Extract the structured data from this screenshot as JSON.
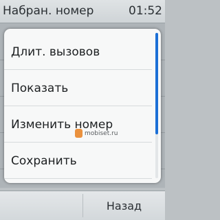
{
  "status_bar": {
    "title": "Набран. номер",
    "time": "01:52"
  },
  "menu": {
    "items": [
      {
        "label": "Длит. вызовов"
      },
      {
        "label": "Показать"
      },
      {
        "label": "Изменить номер"
      },
      {
        "label": "Сохранить"
      }
    ],
    "scroll_fraction": 0.7
  },
  "watermark": {
    "text": "mobiset.ru"
  },
  "softkeys": {
    "right_label": "Назад"
  },
  "colors": {
    "accent": "#1b6fd6",
    "popup_bg": "#f7f8f8"
  }
}
